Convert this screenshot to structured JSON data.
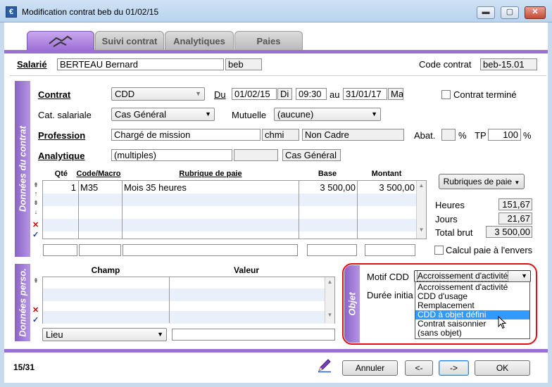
{
  "window": {
    "title": "Modification contrat beb du 01/02/15",
    "min": "▬",
    "max": "▢",
    "close": "✕"
  },
  "tabs": [
    {
      "label": ""
    },
    {
      "label": "Suivi contrat"
    },
    {
      "label": "Analytiques"
    },
    {
      "label": "Paies"
    }
  ],
  "header": {
    "salarie_label": "Salarié",
    "salarie_name": "BERTEAU Bernard",
    "salarie_code": "beb",
    "code_contrat_label": "Code contrat",
    "code_contrat": "beb-15.01"
  },
  "contrat": {
    "section_label": "Données du contrat",
    "contrat_label": "Contrat",
    "contrat_value": "CDD",
    "du_label": "Du",
    "date_from": "01/02/15",
    "day_from": "Di",
    "time": "09:30",
    "au_label": "au",
    "date_to": "31/01/17",
    "day_to": "Ma",
    "termine_label": "Contrat terminé",
    "cat_label": "Cat. salariale",
    "cat_value": "Cas Général",
    "mutuelle_label": "Mutuelle",
    "mutuelle_value": "(aucune)",
    "profession_label": "Profession",
    "profession_value": "Chargé de mission",
    "profession_code": "chmi",
    "profession_status": "Non Cadre",
    "abat_label": "Abat.",
    "abat_value": "",
    "pct1": "%",
    "tp_label": "TP",
    "tp_value": "100",
    "pct2": "%",
    "analytique_label": "Analytique",
    "analytique_value": "(multiples)",
    "analytique_code": "",
    "analytique_cat": "Cas Général"
  },
  "paie_grid": {
    "headers": {
      "qte": "Qté",
      "code": "Code/Macro",
      "rubrique": "Rubrique de paie",
      "base": "Base",
      "montant": "Montant"
    },
    "rows": [
      {
        "qte": "1",
        "code": "M35",
        "rubrique": "Mois 35 heures",
        "base": "3 500,00",
        "montant": "3 500,00"
      }
    ],
    "rubriques_button": "Rubriques de paie",
    "heures_label": "Heures",
    "heures_value": "151,67",
    "jours_label": "Jours",
    "jours_value": "21,67",
    "total_label": "Total brut",
    "total_value": "3 500,00",
    "calcul_label": "Calcul paie à l'envers"
  },
  "perso": {
    "section_label": "Données perso.",
    "champ_header": "Champ",
    "valeur_header": "Valeur",
    "lieu_value": "Lieu"
  },
  "objet": {
    "section_label": "Objet",
    "motif_label": "Motif CDD",
    "motif_value": "Accroissement d'activité",
    "duree_label": "Durée initia",
    "options": [
      "Accroissement d'activité",
      "CDD d'usage",
      "Remplacement",
      "CDD à objet défini",
      "Contrat saisonnier",
      "(sans objet)"
    ],
    "highlighted_option": "CDD à objet défini"
  },
  "footer": {
    "record": "15/31",
    "annuler": "Annuler",
    "prev": "<-",
    "next": "->",
    "ok": "OK"
  },
  "colors": {
    "accent": "#9a6fd3",
    "highlight": "#3399ff",
    "callout": "#e01010"
  }
}
